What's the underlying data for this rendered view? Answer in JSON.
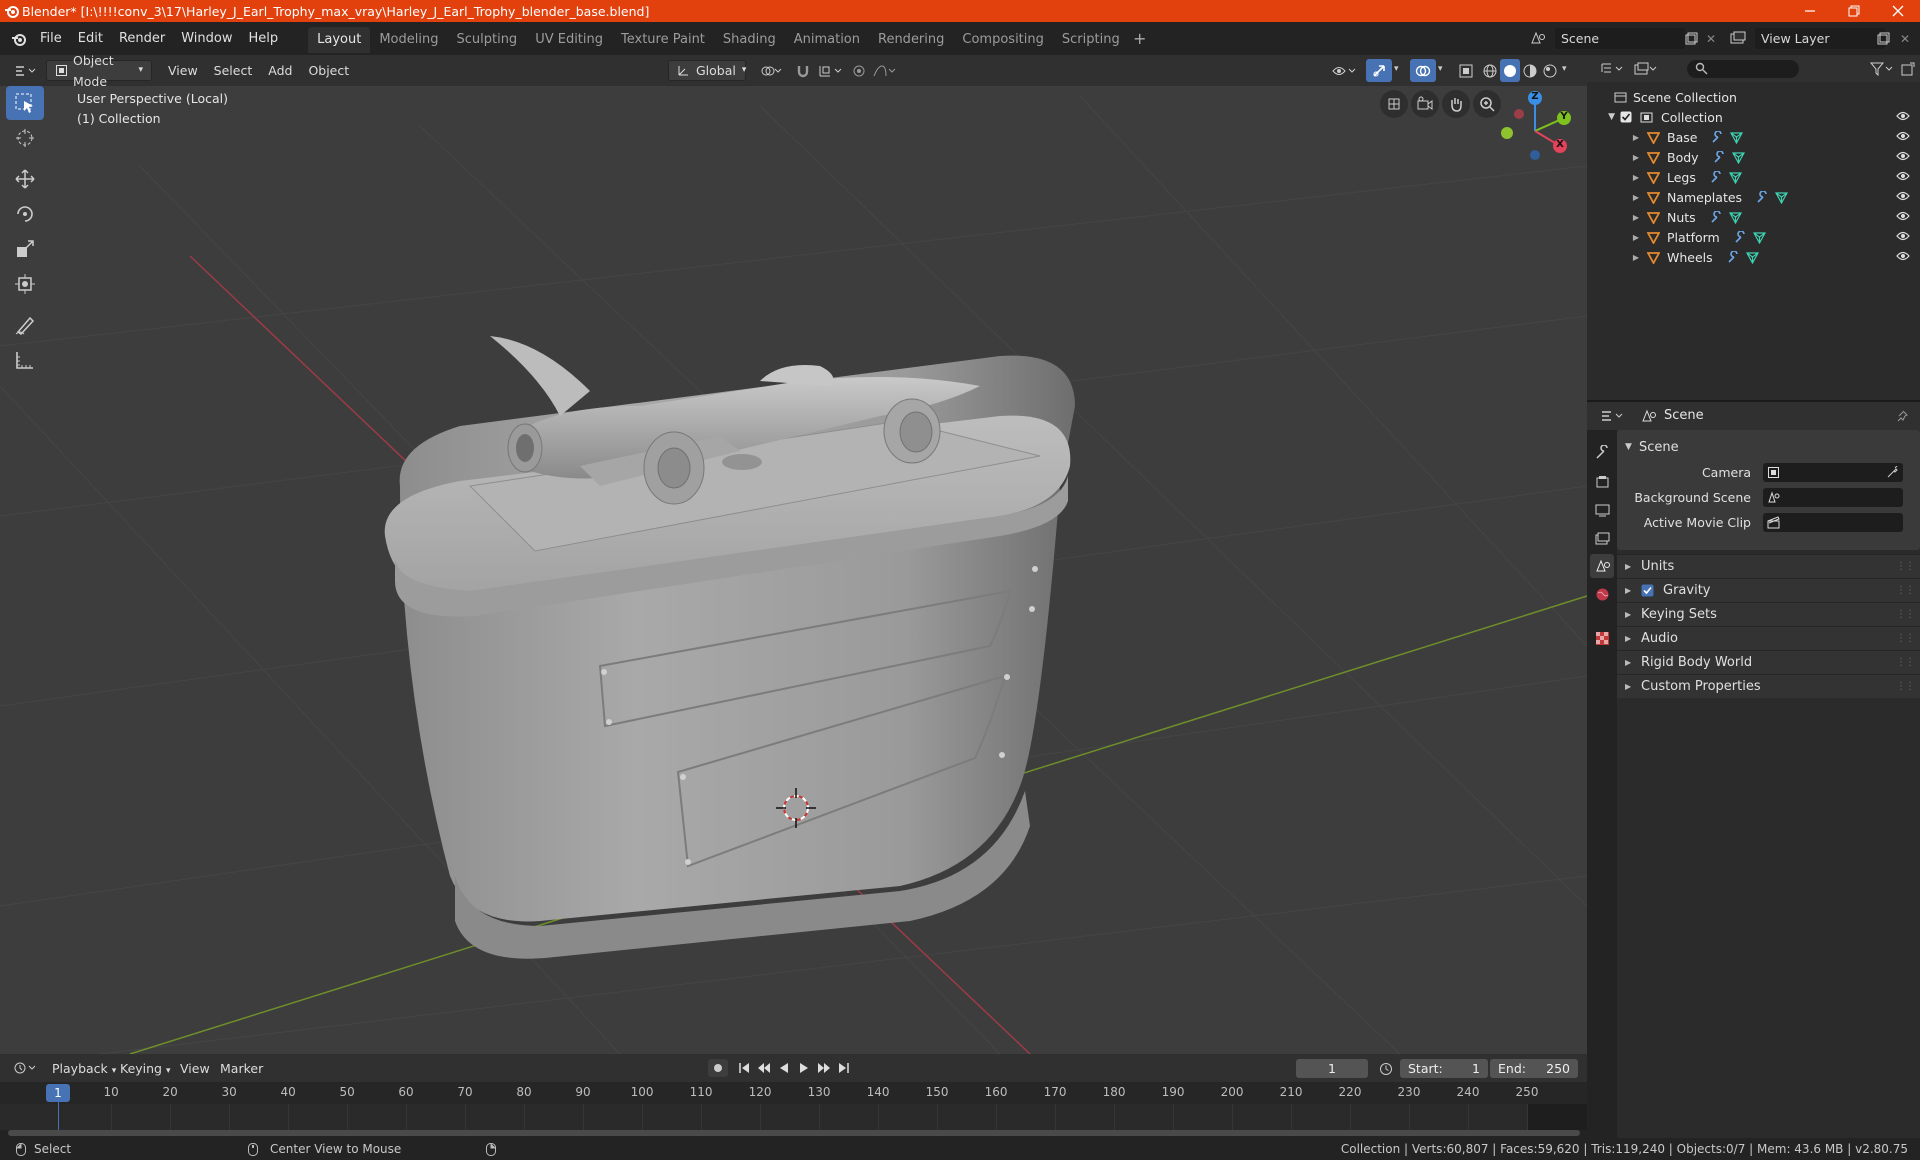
{
  "window": {
    "title": "Blender* [I:\\!!!!conv_3\\17\\Harley_J_Earl_Trophy_max_vray\\Harley_J_Earl_Trophy_blender_base.blend]"
  },
  "menubar": {
    "menus": [
      "File",
      "Edit",
      "Render",
      "Window",
      "Help"
    ],
    "workspaces": [
      "Layout",
      "Modeling",
      "Sculpting",
      "UV Editing",
      "Texture Paint",
      "Shading",
      "Animation",
      "Rendering",
      "Compositing",
      "Scripting"
    ],
    "active_workspace": "Layout",
    "scene_name": "Scene",
    "view_layer": "View Layer"
  },
  "viewport_header": {
    "mode": "Object Mode",
    "menus": [
      "View",
      "Select",
      "Add",
      "Object"
    ],
    "orientation": "Global"
  },
  "viewport": {
    "perspective_label": "User Perspective (Local)",
    "collection_label": "(1) Collection",
    "gizmo_axes": [
      "Z",
      "Y",
      "X"
    ]
  },
  "outliner": {
    "root": "Scene Collection",
    "collection": "Collection",
    "objects": [
      "Base",
      "Body",
      "Legs",
      "Nameplates",
      "Nuts",
      "Platform",
      "Wheels"
    ]
  },
  "properties": {
    "context": "Scene",
    "panel_title": "Scene",
    "fields": [
      {
        "label": "Camera"
      },
      {
        "label": "Background Scene"
      },
      {
        "label": "Active Movie Clip"
      }
    ],
    "sections": [
      "Units",
      "Gravity",
      "Keying Sets",
      "Audio",
      "Rigid Body World",
      "Custom Properties"
    ],
    "gravity_checked": true
  },
  "timeline": {
    "menus": [
      "Playback",
      "Keying",
      "View",
      "Marker"
    ],
    "current_frame": "1",
    "start_label": "Start:",
    "start": "1",
    "end_label": "End:",
    "end": "250",
    "ruler": [
      "10",
      "20",
      "30",
      "40",
      "50",
      "60",
      "70",
      "80",
      "90",
      "100",
      "110",
      "120",
      "130",
      "140",
      "150",
      "160",
      "170",
      "180",
      "190",
      "200",
      "210",
      "220",
      "230",
      "240",
      "250"
    ]
  },
  "statusbar": {
    "left_action": "Select",
    "middle_action": "Center View to Mouse",
    "stats": "Collection | Verts:60,807 | Faces:59,620 | Tris:119,240 | Objects:0/7 | Mem: 43.6 MB | v2.80.75"
  },
  "colors": {
    "title_bar": "#e2410e",
    "accent": "#4772b3",
    "object_icon": "#e6892e",
    "modifier_icon": "#6ea7e8",
    "mesh_icon": "#3fd0b0",
    "x_axis": "#e0435a",
    "y_axis": "#7fc21d",
    "z_axis": "#3a8fe5"
  }
}
